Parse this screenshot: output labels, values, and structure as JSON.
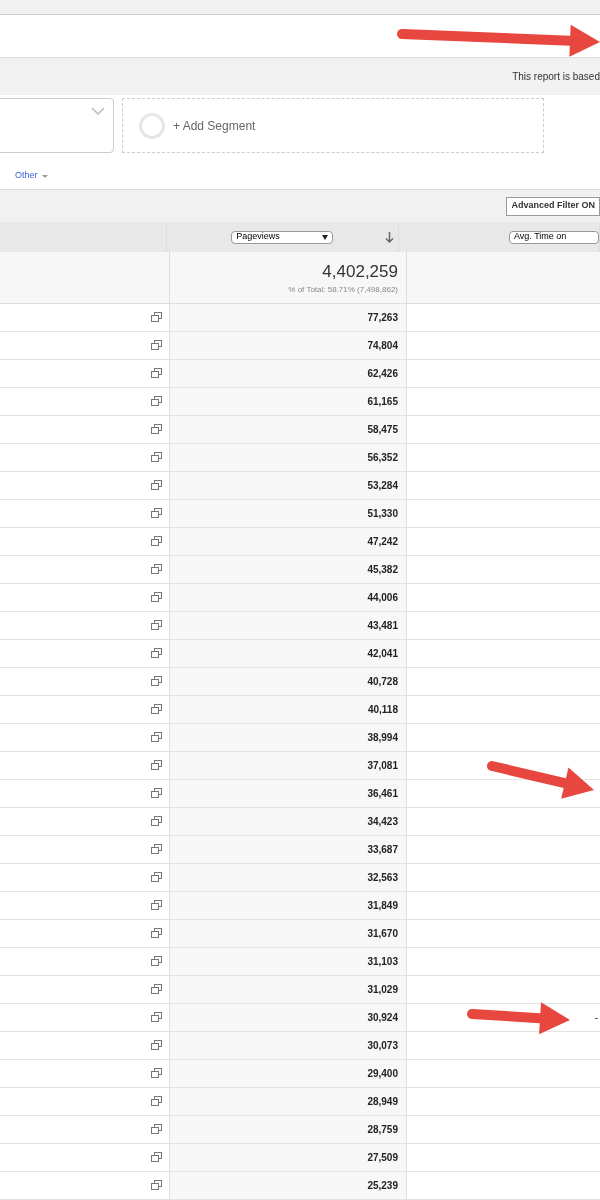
{
  "notice": "This report is based",
  "segment": {
    "add_label": "+ Add Segment"
  },
  "links": [
    {
      "label": "Other"
    }
  ],
  "filter_button": "Advanced Filter ON",
  "table": {
    "columns": [
      {
        "label": "Pageviews",
        "sorted": true
      },
      {
        "label": "Avg. Time on",
        "sorted": false
      }
    ],
    "totals": {
      "value": "4,402,259",
      "share": "% of Total: 58.71% (7,498,862)"
    },
    "rows": [
      {
        "pageviews": "77,263"
      },
      {
        "pageviews": "74,804"
      },
      {
        "pageviews": "62,426"
      },
      {
        "pageviews": "61,165"
      },
      {
        "pageviews": "58,475"
      },
      {
        "pageviews": "56,352"
      },
      {
        "pageviews": "53,284"
      },
      {
        "pageviews": "51,330"
      },
      {
        "pageviews": "47,242"
      },
      {
        "pageviews": "45,382"
      },
      {
        "pageviews": "44,006"
      },
      {
        "pageviews": "43,481"
      },
      {
        "pageviews": "42,041"
      },
      {
        "pageviews": "40,728"
      },
      {
        "pageviews": "40,118"
      },
      {
        "pageviews": "38,994"
      },
      {
        "pageviews": "37,081"
      },
      {
        "pageviews": "36,461"
      },
      {
        "pageviews": "34,423"
      },
      {
        "pageviews": "33,687"
      },
      {
        "pageviews": "32,563"
      },
      {
        "pageviews": "31,849"
      },
      {
        "pageviews": "31,670"
      },
      {
        "pageviews": "31,103"
      },
      {
        "pageviews": "31,029"
      },
      {
        "pageviews": "30,924",
        "column_3": "-"
      },
      {
        "pageviews": "30,073"
      },
      {
        "pageviews": "29,400"
      },
      {
        "pageviews": "28,949"
      },
      {
        "pageviews": "28,759"
      },
      {
        "pageviews": "27,509"
      },
      {
        "pageviews": "25,239"
      }
    ]
  }
}
